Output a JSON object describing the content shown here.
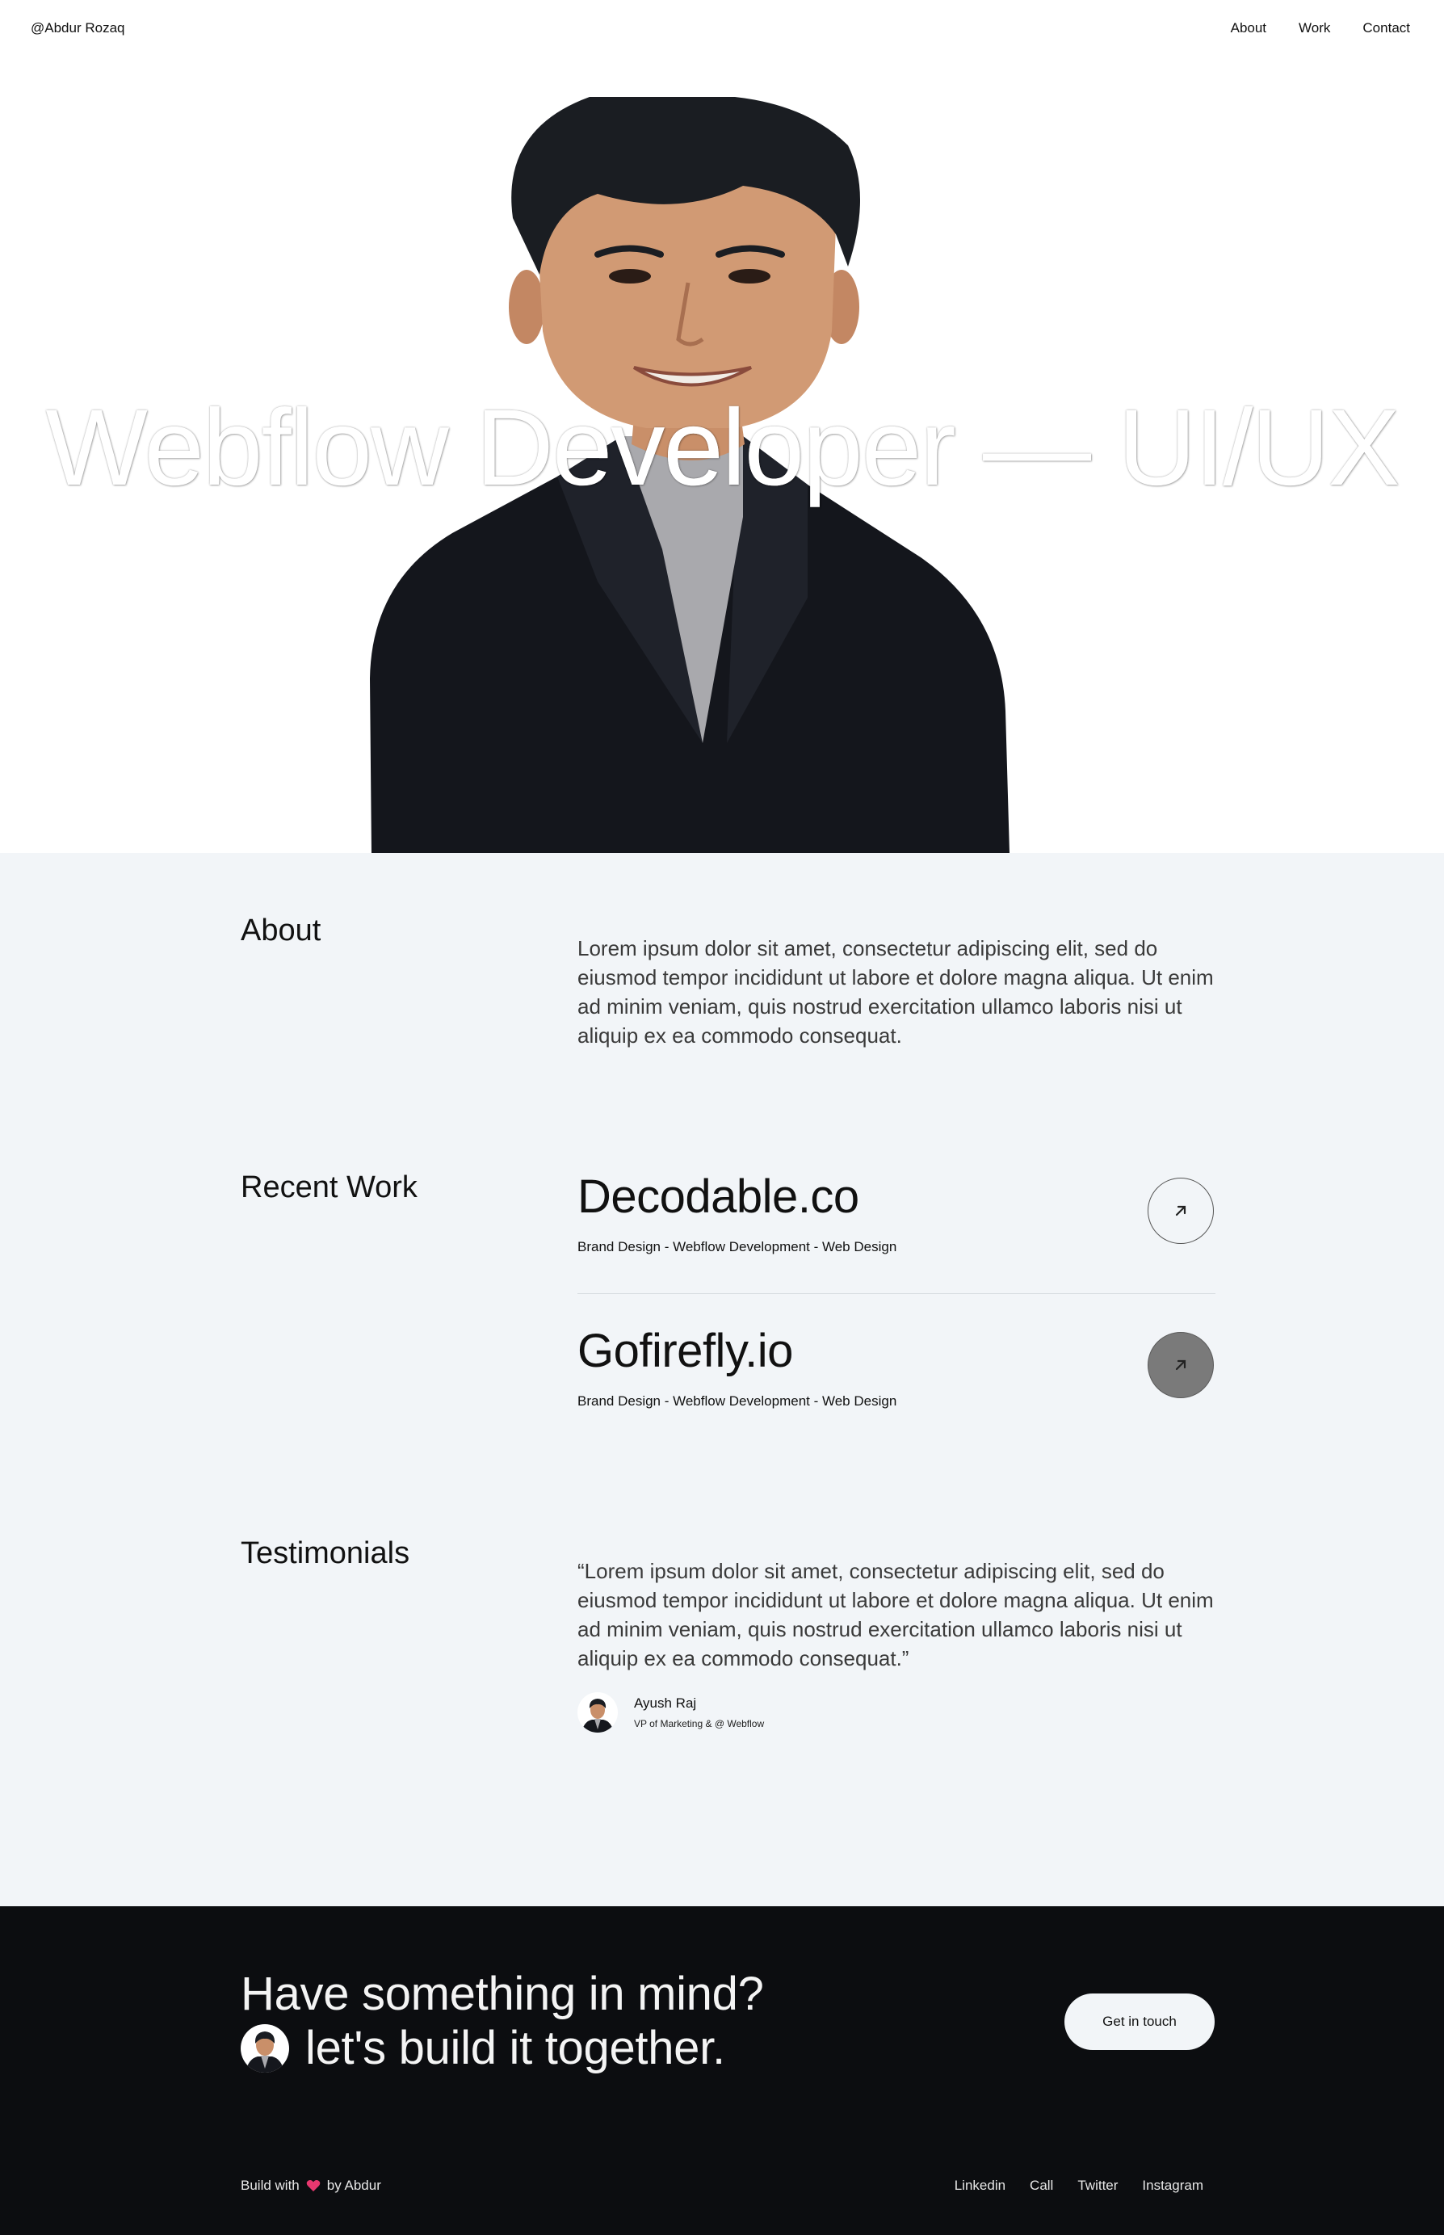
{
  "nav": {
    "brand": "@Abdur Rozaq",
    "links": [
      "About",
      "Work",
      "Contact"
    ]
  },
  "hero": {
    "title": "Webflow Developer — UI/UX"
  },
  "about": {
    "label": "About",
    "text": "Lorem ipsum dolor sit amet, consectetur adipiscing elit, sed do eiusmod tempor incididunt ut labore et dolore magna aliqua. Ut enim ad minim veniam, quis nostrud exercitation ullamco laboris nisi ut aliquip ex ea commodo consequat."
  },
  "work": {
    "label": "Recent Work",
    "items": [
      {
        "title": "Decodable.co",
        "tags": "Brand Design - Webflow Development - Web Design"
      },
      {
        "title": "Gofirefly.io",
        "tags": "Brand Design - Webflow Development - Web Design"
      }
    ]
  },
  "testimonials": {
    "label": "Testimonials",
    "quote": "“Lorem ipsum dolor sit amet, consectetur adipiscing elit, sed do eiusmod tempor incididunt ut labore et dolore magna aliqua. Ut enim ad minim veniam, quis nostrud exercitation ullamco laboris nisi ut aliquip ex ea commodo consequat.”",
    "author": "Ayush Raj",
    "role": "VP of Marketing & @ Webflow"
  },
  "footer": {
    "cta_line1": "Have something in mind?",
    "cta_line2": "let's build it together.",
    "cta_button": "Get in touch",
    "credit_prefix": "Build with",
    "credit_suffix": "by Abdur",
    "social": [
      "Linkedin",
      "Call",
      "Twitter",
      "Instagram"
    ]
  },
  "colors": {
    "section_bg": "#f2f5f8",
    "footer_bg": "#0c0d10",
    "heart": "#e8386f"
  },
  "icons": {
    "work_arrow": "arrow-up-right-icon",
    "credit": "heart-icon"
  }
}
